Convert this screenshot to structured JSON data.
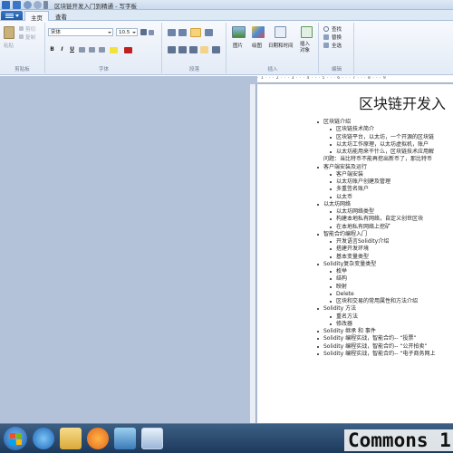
{
  "window": {
    "title": "区块链开发入门到精通 - 写字板"
  },
  "tabs": {
    "home": "主页",
    "view": "查看"
  },
  "ribbon": {
    "clipboard": {
      "paste_label": "粘贴",
      "cut_label": "剪切",
      "copy_label": "复制",
      "group_label": "剪贴板"
    },
    "font": {
      "font_name": "宋体",
      "font_size": "10.5",
      "group_label": "字体",
      "bold": "B",
      "italic": "I",
      "underline": "U"
    },
    "paragraph": {
      "group_label": "段落"
    },
    "insert": {
      "picture_label": "图片",
      "paint_label": "绘图",
      "datetime_label": "日期和时间",
      "object_label": "插入\n对象",
      "group_label": "插入"
    },
    "editing": {
      "find_label": "查找",
      "replace_label": "替换",
      "select_all_label": "全选",
      "group_label": "编辑"
    }
  },
  "ruler": {
    "text": "· 1 · · · 2 · · · 3 · · · 4 · · · 5 · · · 6 · · · 7 · · · 8 · · · 9"
  },
  "document": {
    "title": "区块链开发入",
    "lines": [
      {
        "level": 1,
        "text": "区块链介绍"
      },
      {
        "level": 2,
        "text": "区块链技术简介"
      },
      {
        "level": 2,
        "text": "区块链平台，以太坊，一个开源的区块链"
      },
      {
        "level": 2,
        "text": "以太坊工作原理，以太坊虚拟机，账户"
      },
      {
        "level": 2,
        "text": "以太坊能用来干什么，区块链技术应用解"
      },
      {
        "level": 0,
        "text": "问题：当比特币不能再挖出新币了，那比特币"
      },
      {
        "level": 1,
        "text": "客户端安装及运行"
      },
      {
        "level": 2,
        "text": "客户端安装"
      },
      {
        "level": 2,
        "text": "以太坊账户创建及管理"
      },
      {
        "level": 2,
        "text": "多重签名账户"
      },
      {
        "level": 2,
        "text": "以太币"
      },
      {
        "level": 1,
        "text": "以太坊网络"
      },
      {
        "level": 2,
        "text": "以太坊网络类型"
      },
      {
        "level": 2,
        "text": "构建本地私有网络，自定义创世区块"
      },
      {
        "level": 2,
        "text": "在本地私有网络上挖矿"
      },
      {
        "level": 1,
        "text": "智能合约编程入门"
      },
      {
        "level": 2,
        "text": "开发语言Solidity介绍"
      },
      {
        "level": 2,
        "text": "搭建开发环境"
      },
      {
        "level": 2,
        "text": "基本变量类型"
      },
      {
        "level": 1,
        "text": "Solidity复杂变量类型"
      },
      {
        "level": 2,
        "text": "枚举"
      },
      {
        "level": 2,
        "text": "结构"
      },
      {
        "level": 2,
        "text": "映射"
      },
      {
        "level": 2,
        "text": "Delete"
      },
      {
        "level": 2,
        "text": "区块和交易的常用属性和方法介绍"
      },
      {
        "level": 1,
        "text": "Solidity 方法"
      },
      {
        "level": 2,
        "text": "重名方法"
      },
      {
        "level": 2,
        "text": "修改器"
      },
      {
        "level": 1,
        "text": "Solidity 继承 和 事件"
      },
      {
        "level": 1,
        "text": "Solidity 编程实战，智能合约-- “投票”"
      },
      {
        "level": 1,
        "text": "Solidity 编程实战，智能合约-- “公开拍卖”"
      },
      {
        "level": 1,
        "text": "Solidity 编程实战，智能合约-- “电子商务网上"
      }
    ]
  },
  "taskbar": {
    "watermark": "Commons 1"
  },
  "colors": {
    "accent": "#1f5aa7",
    "workspace": "#b4c2d9",
    "taskbar": "#1c3a5c"
  }
}
